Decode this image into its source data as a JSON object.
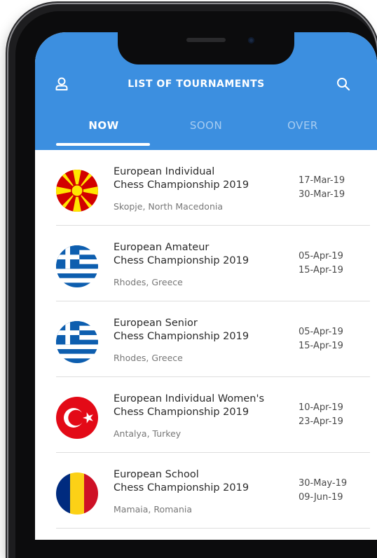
{
  "header": {
    "title": "LIST OF TOURNAMENTS",
    "tabs": [
      "NOW",
      "SOON",
      "OVER"
    ],
    "active_tab": "NOW",
    "user_icon": "user-icon",
    "search_icon": "search-icon"
  },
  "colors": {
    "header_bg": "#3c8fe0",
    "header_text": "#ffffff"
  },
  "tournaments": [
    {
      "name_line1": "European Individual",
      "name_line2": "Chess Championship 2019",
      "location": "Skopje, North Macedonia",
      "start": "17-Mar-19",
      "end": "30-Mar-19",
      "flag": "north-macedonia-flag"
    },
    {
      "name_line1": "European Amateur",
      "name_line2": "Chess Championship 2019",
      "location": "Rhodes, Greece",
      "start": "05-Apr-19",
      "end": "15-Apr-19",
      "flag": "greece-flag"
    },
    {
      "name_line1": "European Senior",
      "name_line2": "Chess Championship 2019",
      "location": "Rhodes, Greece",
      "start": "05-Apr-19",
      "end": "15-Apr-19",
      "flag": "greece-flag"
    },
    {
      "name_line1": "European Individual Women's",
      "name_line2": "Chess Championship 2019",
      "location": "Antalya, Turkey",
      "start": "10-Apr-19",
      "end": "23-Apr-19",
      "flag": "turkey-flag"
    },
    {
      "name_line1": "European School",
      "name_line2": "Chess Championship 2019",
      "location": "Mamaia, Romania",
      "start": "30-May-19",
      "end": "09-Jun-19",
      "flag": "romania-flag"
    }
  ]
}
